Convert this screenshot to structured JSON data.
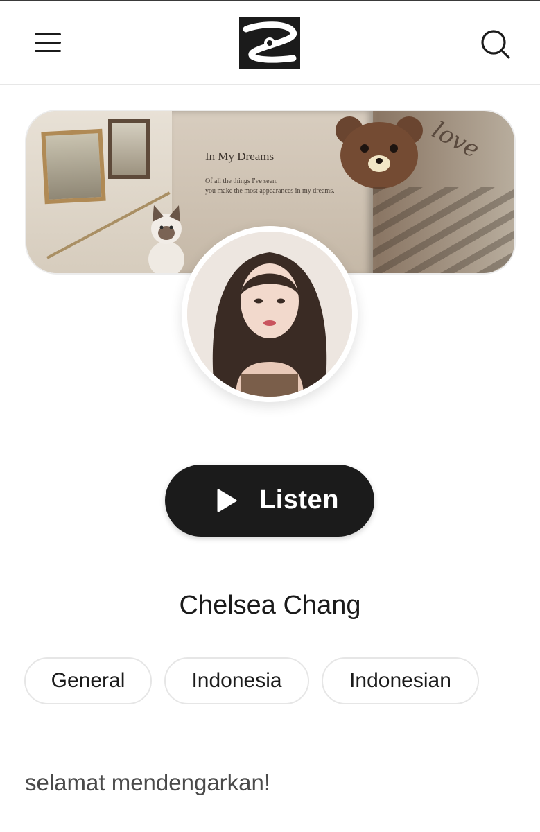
{
  "header": {
    "menu_icon": "hamburger-menu-icon",
    "logo_icon": "app-logo",
    "search_icon": "search-icon"
  },
  "banner": {
    "book_title": "In My Dreams",
    "book_line_1": "Of all the things I've seen,",
    "book_line_2": "you make the most appearances in my dreams.",
    "script_text": "love"
  },
  "profile": {
    "listen_label": "Listen",
    "play_icon": "play-icon",
    "name": "Chelsea Chang",
    "tags": [
      "General",
      "Indonesia",
      "Indonesian"
    ],
    "description": "selamat mendengarkan!"
  },
  "colors": {
    "accent": "#1b1b1b",
    "background": "#ffffff",
    "tag_border": "#e6e6e6"
  }
}
